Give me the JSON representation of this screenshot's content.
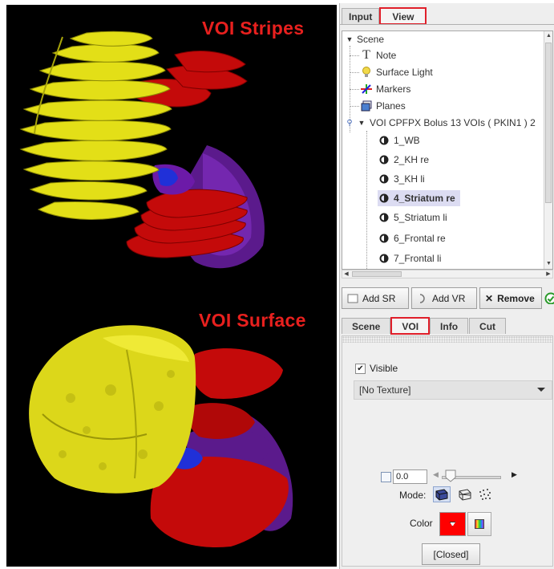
{
  "viewer": {
    "stripes_label": "VOI Stripes",
    "surface_label": "VOI Surface"
  },
  "top_tabs": [
    {
      "label": "Input",
      "active": false
    },
    {
      "label": "View",
      "active": true,
      "highlighted": true
    }
  ],
  "tree": {
    "items": [
      {
        "label": "Scene",
        "icon": "expand-triangle-icon",
        "level": 0
      },
      {
        "label": "Note",
        "icon": "text-T-icon",
        "level": 1
      },
      {
        "label": "Surface Light",
        "icon": "lightbulb-icon",
        "level": 1
      },
      {
        "label": "Markers",
        "icon": "markers-icon",
        "level": 1
      },
      {
        "label": "Planes",
        "icon": "planes-icon",
        "level": 1
      },
      {
        "label": "VOI CPFPX Bolus 13 VOIs ( PKIN1 ) 2",
        "icon": "expand-triangle-icon",
        "level": 1
      },
      {
        "label": "1_WB",
        "icon": "voi-icon",
        "level": 2
      },
      {
        "label": "2_KH re",
        "icon": "voi-icon",
        "level": 2
      },
      {
        "label": "3_KH li",
        "icon": "voi-icon",
        "level": 2
      },
      {
        "label": "4_Striatum re",
        "icon": "voi-icon",
        "level": 2,
        "selected": true
      },
      {
        "label": "5_Striatum li",
        "icon": "voi-icon",
        "level": 2
      },
      {
        "label": "6_Frontal re",
        "icon": "voi-icon",
        "level": 2
      },
      {
        "label": "7_Frontal li",
        "icon": "voi-icon",
        "level": 2
      }
    ]
  },
  "buttons": {
    "add_sr": "Add SR",
    "add_vr": "Add VR",
    "remove": "Remove"
  },
  "lower_tabs": [
    {
      "label": "Scene",
      "active": false
    },
    {
      "label": "VOI",
      "active": true,
      "highlighted": true
    },
    {
      "label": "Info",
      "active": false
    },
    {
      "label": "Cut",
      "active": false
    }
  ],
  "voi": {
    "visible_label": "Visible",
    "visible_checked": true,
    "texture_value": "[No Texture]",
    "transparency_value": "0.0",
    "mode_label": "Mode:",
    "color_label": "Color",
    "color_value": "#ff0000",
    "closed_button": "[Closed]"
  },
  "colors": {
    "highlight": "#e01f2a",
    "label_red": "#e8201e",
    "yellow": "#e6e21a",
    "red": "#c90d0d",
    "purple": "#6a1a9a",
    "blue": "#1a2ad0"
  }
}
